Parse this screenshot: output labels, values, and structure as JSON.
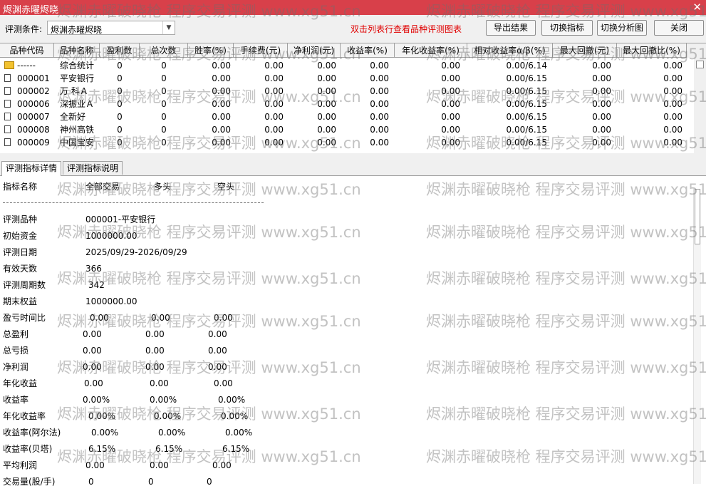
{
  "window": {
    "title": "烬渊赤曜烬晓",
    "close_glyph": "✕"
  },
  "toolbar": {
    "condition_label": "评测条件:",
    "condition_value": "烬渊赤曜烬晓",
    "hint": "双击列表行查看品种评测图表",
    "buttons": [
      "导出结果",
      "切换指标",
      "切换分析图",
      "关闭"
    ]
  },
  "table": {
    "headers": [
      "品种代码",
      "品种名称",
      "盈利数",
      "总次数",
      "胜率(%)",
      "手续费(元)",
      "净利润(元)",
      "收益率(%)",
      "年化收益率(%)",
      "相对收益率α/β(%)",
      "最大回撤(元)",
      "最大回撤比(%)"
    ],
    "rows": [
      [
        "------",
        "综合统计",
        "0",
        "0",
        "0.00",
        "0.00",
        "0.00",
        "0.00",
        "0.00",
        "0.00/6.14",
        "0.00",
        "0.00"
      ],
      [
        "000001",
        "平安银行",
        "0",
        "0",
        "0.00",
        "0.00",
        "0.00",
        "0.00",
        "0.00",
        "0.00/6.15",
        "0.00",
        "0.00"
      ],
      [
        "000002",
        "万 科Ａ",
        "0",
        "0",
        "0.00",
        "0.00",
        "0.00",
        "0.00",
        "0.00",
        "0.00/6.15",
        "0.00",
        "0.00"
      ],
      [
        "000006",
        "深振业Ａ",
        "0",
        "0",
        "0.00",
        "0.00",
        "0.00",
        "0.00",
        "0.00",
        "0.00/6.15",
        "0.00",
        "0.00"
      ],
      [
        "000007",
        "全新好",
        "0",
        "0",
        "0.00",
        "0.00",
        "0.00",
        "0.00",
        "0.00",
        "0.00/6.15",
        "0.00",
        "0.00"
      ],
      [
        "000008",
        "神州高铁",
        "0",
        "0",
        "0.00",
        "0.00",
        "0.00",
        "0.00",
        "0.00",
        "0.00/6.15",
        "0.00",
        "0.00"
      ],
      [
        "000009",
        "中国宝安",
        "0",
        "0",
        "0.00",
        "0.00",
        "0.00",
        "0.00",
        "0.00",
        "0.00/6.15",
        "0.00",
        "0.00"
      ]
    ]
  },
  "tabs": [
    "评测指标详情",
    "评测指标说明"
  ],
  "detail": {
    "header": [
      "指标名称",
      "全部交易",
      "多头",
      "空头"
    ],
    "rows": [
      [
        "评测品种",
        "000001-平安银行",
        "",
        ""
      ],
      [
        "初始资金",
        "1000000.00",
        "",
        ""
      ],
      [
        "评测日期",
        "2025/09/29-2026/09/29",
        "",
        ""
      ],
      [
        "有效天数",
        "366",
        "",
        ""
      ],
      [
        "评测周期数",
        "342",
        "",
        ""
      ],
      [
        "期末权益",
        "1000000.00",
        "",
        ""
      ],
      [
        "盈亏时间比",
        "0.00",
        "0.00",
        "0.00"
      ],
      [
        "总盈利",
        "0.00",
        "0.00",
        "0.00"
      ],
      [
        "总亏损",
        "0.00",
        "0.00",
        "0.00"
      ],
      [
        "净利润",
        "0.00",
        "0.00",
        "0.00"
      ],
      [
        "年化收益",
        "0.00",
        "0.00",
        "0.00"
      ],
      [
        "收益率",
        "0.00%",
        "0.00%",
        "0.00%"
      ],
      [
        "年化收益率",
        "0.00%",
        "0.00%",
        "0.00%"
      ],
      [
        "收益率(阿尔法)",
        "0.00%",
        "0.00%",
        "0.00%"
      ],
      [
        "收益率(贝塔)",
        "6.15%",
        "6.15%",
        "6.15%"
      ],
      [
        "平均利润",
        "0.00",
        "0.00",
        "0.00"
      ],
      [
        "交易量(股/手)",
        "0",
        "0",
        "0"
      ]
    ]
  },
  "watermark": {
    "text": "烬渊赤曜破晓枪 程序交易评测 www.xg51.cn"
  },
  "colors": {
    "titlebar": "#d8404a",
    "hint": "#e00000",
    "summary_icon": "#f2c230"
  }
}
